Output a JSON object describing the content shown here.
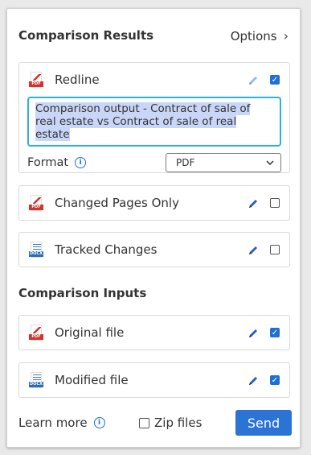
{
  "header": {
    "title": "Comparison Results",
    "options_label": "Options"
  },
  "outputs": [
    {
      "icon": "pdf-icon",
      "badge": "PDF",
      "label": "Redline",
      "checked": true,
      "textbox": "Comparison output - Contract of sale of real estate vs Contract of sale of real estate",
      "format_label": "Format",
      "format_value": "PDF"
    },
    {
      "icon": "pdf-icon",
      "badge": "PDF",
      "label": "Changed Pages Only",
      "checked": false
    },
    {
      "icon": "docx-icon",
      "badge": "DOCX",
      "label": "Tracked Changes",
      "checked": false
    }
  ],
  "inputs_title": "Comparison Inputs",
  "inputs": [
    {
      "icon": "pdf-icon",
      "badge": "PDF",
      "label": "Original file",
      "checked": true
    },
    {
      "icon": "docx-icon",
      "badge": "DOCX",
      "label": "Modified file",
      "checked": true
    }
  ],
  "footer": {
    "learn_more": "Learn more",
    "zip_label": "Zip files",
    "send_label": "Send"
  },
  "colors": {
    "accent": "#2b73d4",
    "focus": "#2bb3d6",
    "pdf": "#d6322c",
    "docx": "#2a6ebb"
  }
}
